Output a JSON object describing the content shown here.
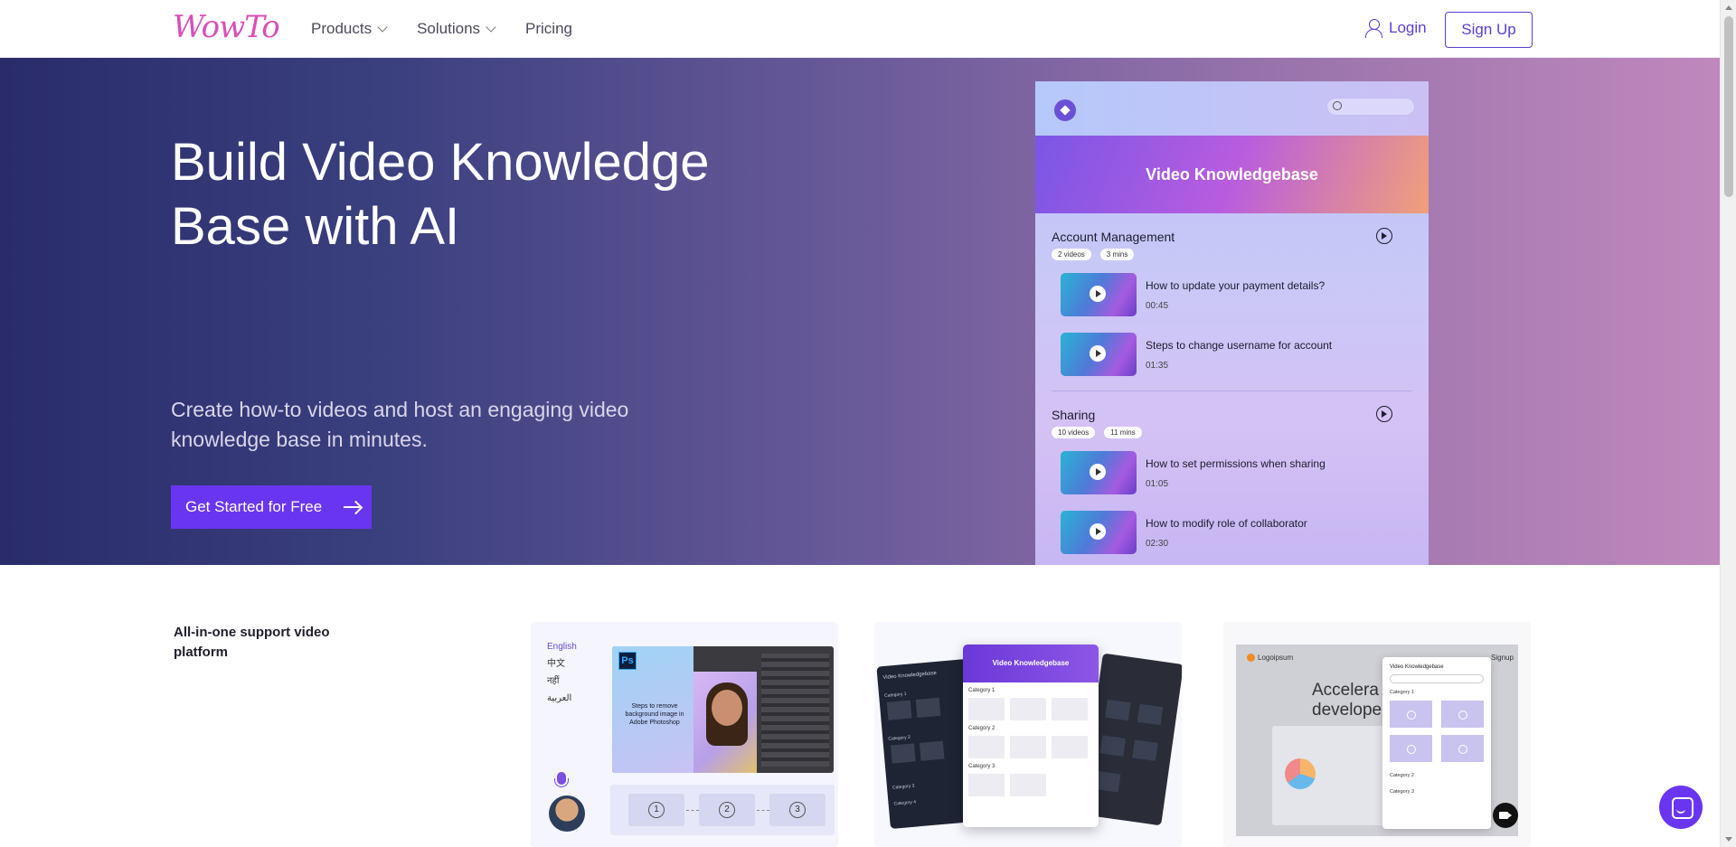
{
  "header": {
    "logo": "WowTo",
    "nav": [
      {
        "label": "Products",
        "has_dropdown": true
      },
      {
        "label": "Solutions",
        "has_dropdown": true
      },
      {
        "label": "Pricing",
        "has_dropdown": false
      }
    ],
    "login_label": "Login",
    "signup_label": "Sign Up"
  },
  "hero": {
    "title_line1": "Build Video Knowledge",
    "title_line2": "Base with AI",
    "subtitle_line1": "Create how-to videos and host an engaging video",
    "subtitle_line2": "knowledge base in minutes.",
    "cta_label": "Get Started for Free"
  },
  "mock": {
    "banner": "Video Knowledgebase",
    "sections": [
      {
        "title": "Account Management",
        "videos_chip": "2 videos",
        "time_chip": "3 mins",
        "items": [
          {
            "title": "How to update your payment details?",
            "duration": "00:45"
          },
          {
            "title": "Steps to change username for account",
            "duration": "01:35"
          }
        ]
      },
      {
        "title": "Sharing",
        "videos_chip": "10 videos",
        "time_chip": "11 mins",
        "items": [
          {
            "title": "How to set permissions when sharing",
            "duration": "01:05"
          },
          {
            "title": "How to modify role of collaborator",
            "duration": "02:30"
          }
        ]
      }
    ]
  },
  "features": {
    "label_line1": "All-in-one support video",
    "label_line2": "platform",
    "card1": {
      "languages": [
        "English",
        "中文",
        "नहीं",
        "العربية"
      ],
      "ps_badge": "Ps",
      "caption": "Steps to remove background image in Adobe Photoshop",
      "steps": [
        "1",
        "2",
        "3"
      ]
    },
    "card2": {
      "title": "Video Knowledgebase",
      "left_title": "Video Knowledgebase",
      "categories": [
        "Category 1",
        "Category 2",
        "Category 3"
      ],
      "left_categories": [
        "Category 1",
        "Category 2",
        "Category 3",
        "Category 4"
      ]
    },
    "card3": {
      "brand": "Logoipsum",
      "headline_line1": "Accelera",
      "headline_line2": "developer",
      "nav_signup": "Signup",
      "widget_title": "Video Knowledgebase",
      "categories": [
        "Category 1",
        "Category 2",
        "Category 3"
      ]
    }
  },
  "colors": {
    "accent": "#6a35f0",
    "brand_pink": "#d84fb8",
    "link": "#5a3fd6"
  },
  "icons": [
    "user-icon",
    "chevron-down-icon",
    "arrow-right-icon",
    "play-icon",
    "search-icon",
    "mic-icon",
    "chat-icon",
    "camera-icon"
  ]
}
